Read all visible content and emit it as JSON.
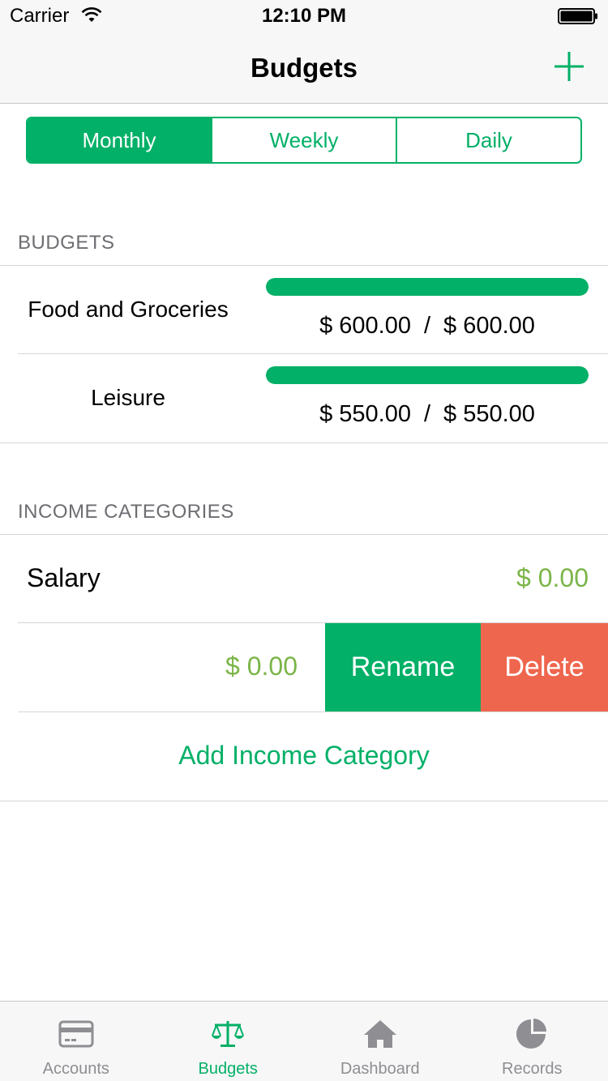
{
  "status_bar": {
    "carrier": "Carrier",
    "time": "12:10 PM"
  },
  "nav": {
    "title": "Budgets"
  },
  "segments": [
    {
      "label": "Monthly",
      "active": true
    },
    {
      "label": "Weekly",
      "active": false
    },
    {
      "label": "Daily",
      "active": false
    }
  ],
  "budgets_section": {
    "header": "BUDGETS",
    "items": [
      {
        "name": "Food and Groceries",
        "spent": "$ 600.00",
        "separator": "/",
        "limit": "$ 600.00",
        "progress": 1.0
      },
      {
        "name": "Leisure",
        "spent": "$ 550.00",
        "separator": "/",
        "limit": "$ 550.00",
        "progress": 1.0
      }
    ]
  },
  "income_section": {
    "header": "INCOME CATEGORIES",
    "items": [
      {
        "name": "Salary",
        "value": "$ 0.00"
      },
      {
        "name": "",
        "value": "$ 0.00"
      }
    ],
    "swipe_actions": {
      "rename": "Rename",
      "delete": "Delete"
    },
    "add_label": "Add Income Category"
  },
  "tabs": [
    {
      "label": "Accounts",
      "icon": "credit-card-icon",
      "active": false
    },
    {
      "label": "Budgets",
      "icon": "scales-icon",
      "active": true
    },
    {
      "label": "Dashboard",
      "icon": "home-icon",
      "active": false
    },
    {
      "label": "Records",
      "icon": "pie-chart-icon",
      "active": false
    }
  ],
  "colors": {
    "accent": "#02b067",
    "income_value": "#7bb548",
    "delete": "#ef664e",
    "tab_inactive": "#8e8e93"
  }
}
